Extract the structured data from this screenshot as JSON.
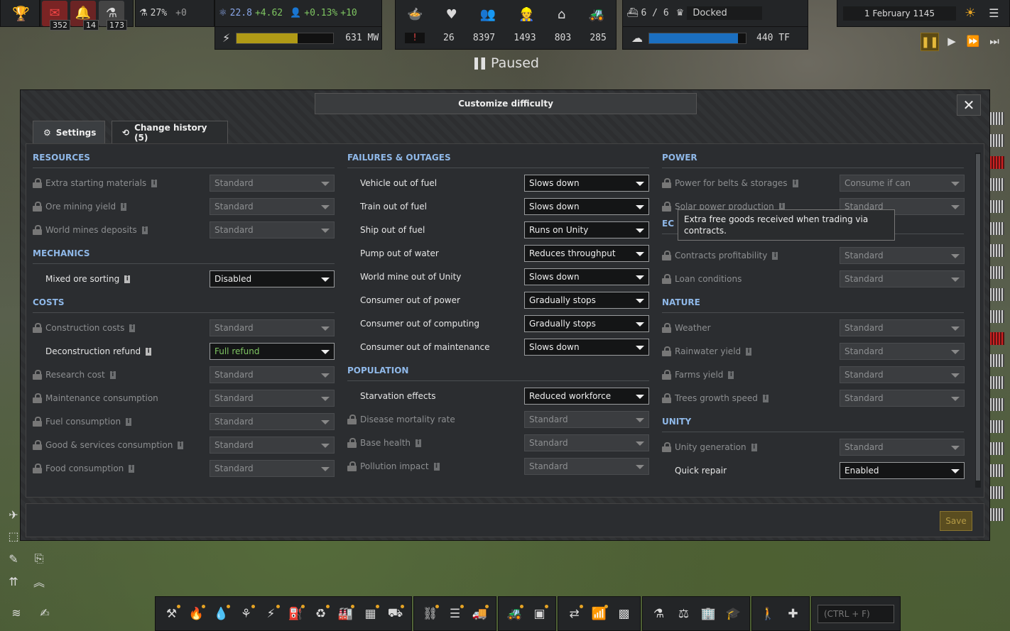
{
  "topbar": {
    "mail_count": "352",
    "alerts_count": "14",
    "research_count": "173",
    "research_pct": "27%",
    "research_delta": "+0",
    "unity": "22.8",
    "unity_delta": "+4.62",
    "pop_growth": "+0.13%",
    "pop_delta": "+10",
    "power": "631 MW",
    "food_warn": "!",
    "health": "26",
    "population": "8397",
    "workers": "1493",
    "housing": "803",
    "vehicles": "285",
    "ships": "6 / 6",
    "ship_status": "Docked",
    "computing": "440 TF",
    "date": "1 February 1145",
    "paused_label": "Paused",
    "power_fill": 0.63,
    "computing_fill": 0.92,
    "colors": {
      "power_bar": "#b09a16",
      "computing_bar": "#1b6fc0",
      "accent": "#e5a324"
    }
  },
  "modal": {
    "title": "Customize difficulty",
    "close_icon": "close-icon",
    "tabs": [
      {
        "label": "Settings",
        "icon": "gear-icon"
      },
      {
        "label": "Change history (5)",
        "icon": "history-icon"
      }
    ],
    "tooltip": "Extra free goods received when trading via contracts.",
    "save_label": "Save",
    "col1": {
      "resources_head": "RESOURCES",
      "resources": [
        {
          "label": "Extra starting materials",
          "value": "Standard",
          "locked": true,
          "info": true
        },
        {
          "label": "Ore mining yield",
          "value": "Standard",
          "locked": true,
          "info": true
        },
        {
          "label": "World mines deposits",
          "value": "Standard",
          "locked": true,
          "info": true
        }
      ],
      "mechanics_head": "MECHANICS",
      "mechanics": [
        {
          "label": "Mixed ore sorting",
          "value": "Disabled",
          "locked": false,
          "info": true
        }
      ],
      "costs_head": "COSTS",
      "costs": [
        {
          "label": "Construction costs",
          "value": "Standard",
          "locked": true,
          "info": true
        },
        {
          "label": "Deconstruction refund",
          "value": "Full refund",
          "locked": false,
          "info": true
        },
        {
          "label": "Research cost",
          "value": "Standard",
          "locked": true,
          "info": true
        },
        {
          "label": "Maintenance consumption",
          "value": "Standard",
          "locked": true,
          "info": false
        },
        {
          "label": "Fuel consumption",
          "value": "Standard",
          "locked": true,
          "info": true
        },
        {
          "label": "Good & services consumption",
          "value": "Standard",
          "locked": true,
          "info": true
        },
        {
          "label": "Food consumption",
          "value": "Standard",
          "locked": true,
          "info": true
        }
      ]
    },
    "col2": {
      "failures_head": "FAILURES & OUTAGES",
      "failures": [
        {
          "label": "Vehicle out of fuel",
          "value": "Slows down"
        },
        {
          "label": "Train out of fuel",
          "value": "Slows down"
        },
        {
          "label": "Ship out of fuel",
          "value": "Runs on Unity"
        },
        {
          "label": "Pump out of water",
          "value": "Reduces throughput"
        },
        {
          "label": "World mine out of Unity",
          "value": "Slows down"
        },
        {
          "label": "Consumer out of power",
          "value": "Gradually stops"
        },
        {
          "label": "Consumer out of computing",
          "value": "Gradually stops"
        },
        {
          "label": "Consumer out of maintenance",
          "value": "Slows down"
        }
      ],
      "population_head": "POPULATION",
      "population": [
        {
          "label": "Starvation effects",
          "value": "Reduced workforce",
          "locked": false,
          "info": false
        },
        {
          "label": "Disease mortality rate",
          "value": "Standard",
          "locked": true,
          "info": false
        },
        {
          "label": "Base health",
          "value": "Standard",
          "locked": true,
          "info": true
        },
        {
          "label": "Pollution impact",
          "value": "Standard",
          "locked": true,
          "info": true
        }
      ]
    },
    "col3": {
      "power_head": "POWER",
      "power": [
        {
          "label": "Power for belts & storages",
          "value": "Consume if can",
          "locked": true,
          "info": true
        },
        {
          "label": "Solar power production",
          "value": "Standard",
          "locked": true,
          "info": true
        }
      ],
      "economy_head": "EC",
      "economy": [
        {
          "label": "Contracts profitability",
          "value": "Standard",
          "locked": true,
          "info": true
        },
        {
          "label": "Loan conditions",
          "value": "Standard",
          "locked": true,
          "info": false
        }
      ],
      "nature_head": "NATURE",
      "nature": [
        {
          "label": "Weather",
          "value": "Standard",
          "locked": true,
          "info": false
        },
        {
          "label": "Rainwater yield",
          "value": "Standard",
          "locked": true,
          "info": true
        },
        {
          "label": "Farms yield",
          "value": "Standard",
          "locked": true,
          "info": true
        },
        {
          "label": "Trees growth speed",
          "value": "Standard",
          "locked": true,
          "info": true
        }
      ],
      "unity_head": "UNITY",
      "unity": [
        {
          "label": "Unity generation",
          "value": "Standard",
          "locked": true,
          "info": true
        },
        {
          "label": "Quick repair",
          "value": "Enabled",
          "locked": false,
          "info": false
        }
      ]
    }
  },
  "bottombar": {
    "search_placeholder": "(CTRL + F)"
  }
}
